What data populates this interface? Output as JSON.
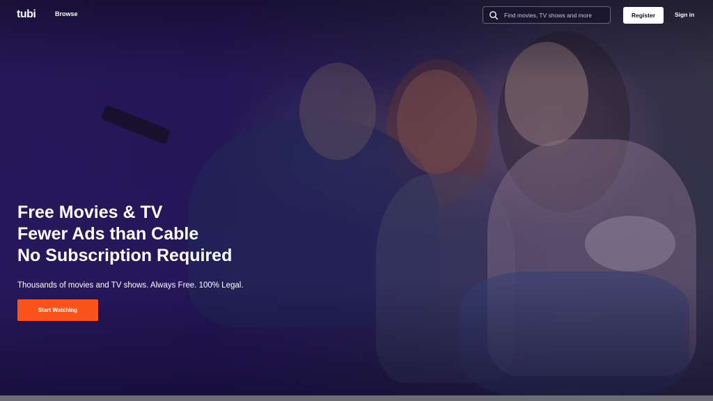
{
  "header": {
    "logo_text": "tubi",
    "nav_browse": "Browse",
    "search": {
      "placeholder": "Find movies, TV shows and more",
      "icon": "search-icon"
    },
    "register_label": "Register",
    "signin_label": "Sign in"
  },
  "hero": {
    "title_lines": [
      "Free Movies & TV",
      "Fewer Ads than Cable",
      "No Subscription Required"
    ],
    "subtitle": "Thousands of movies and TV shows. Always Free. 100% Legal.",
    "cta_label": "Start Watching"
  },
  "colors": {
    "accent": "#fa541c",
    "hero_overlay": "#2a1a5e",
    "text": "#ffffff"
  }
}
